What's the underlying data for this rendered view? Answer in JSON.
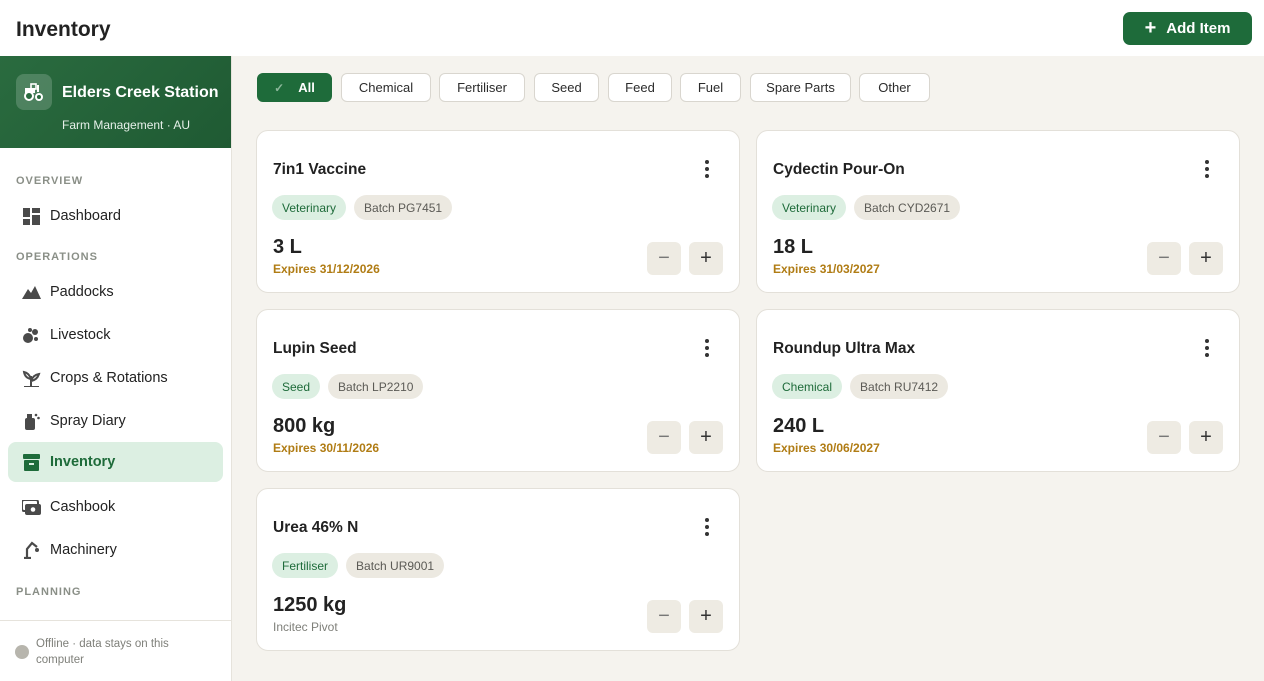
{
  "header": {
    "title": "Inventory",
    "add_label": "Add Item",
    "add_icon": "plus-icon"
  },
  "farm": {
    "name": "Elders Creek Station",
    "subtitle": "Farm Management · AU",
    "icon": "tractor-icon"
  },
  "nav": {
    "overview_label": "OVERVIEW",
    "operations_label": "OPERATIONS",
    "planning_label": "PLANNING",
    "items": [
      {
        "label": "Dashboard",
        "icon": "dashboard-icon"
      },
      {
        "label": "Paddocks",
        "icon": "mountain-icon"
      },
      {
        "label": "Livestock",
        "icon": "livestock-icon"
      },
      {
        "label": "Crops & Rotations",
        "icon": "crop-icon"
      },
      {
        "label": "Spray Diary",
        "icon": "spray-icon"
      },
      {
        "label": "Inventory",
        "icon": "inventory-icon"
      },
      {
        "label": "Cashbook",
        "icon": "cashbook-icon"
      },
      {
        "label": "Machinery",
        "icon": "machinery-icon"
      }
    ],
    "active": "Inventory"
  },
  "status": {
    "offline_text": "Offline · data stays on this computer"
  },
  "filters": {
    "items": [
      "All",
      "Chemical",
      "Fertiliser",
      "Seed",
      "Feed",
      "Fuel",
      "Spare Parts",
      "Other"
    ],
    "active": "All"
  },
  "cards": [
    {
      "name": "7in1 Vaccine",
      "category": "Veterinary",
      "batch": "Batch PG7451",
      "quantity": "3 L",
      "sub": "Expires 31/12/2026",
      "sub_type": "expiry"
    },
    {
      "name": "Cydectin Pour-On",
      "category": "Veterinary",
      "batch": "Batch CYD2671",
      "quantity": "18 L",
      "sub": "Expires 31/03/2027",
      "sub_type": "expiry"
    },
    {
      "name": "Lupin Seed",
      "category": "Seed",
      "batch": "Batch LP2210",
      "quantity": "800 kg",
      "sub": "Expires 30/11/2026",
      "sub_type": "expiry"
    },
    {
      "name": "Roundup Ultra Max",
      "category": "Chemical",
      "batch": "Batch RU7412",
      "quantity": "240 L",
      "sub": "Expires 30/06/2027",
      "sub_type": "expiry"
    },
    {
      "name": "Urea 46% N",
      "category": "Fertiliser",
      "batch": "Batch UR9001",
      "quantity": "1250 kg",
      "sub": "Incitec Pivot",
      "sub_type": "supplier"
    }
  ],
  "colors": {
    "brand": "#1e6b3a",
    "expiry": "#b07c14",
    "background": "#f5f3ee"
  }
}
